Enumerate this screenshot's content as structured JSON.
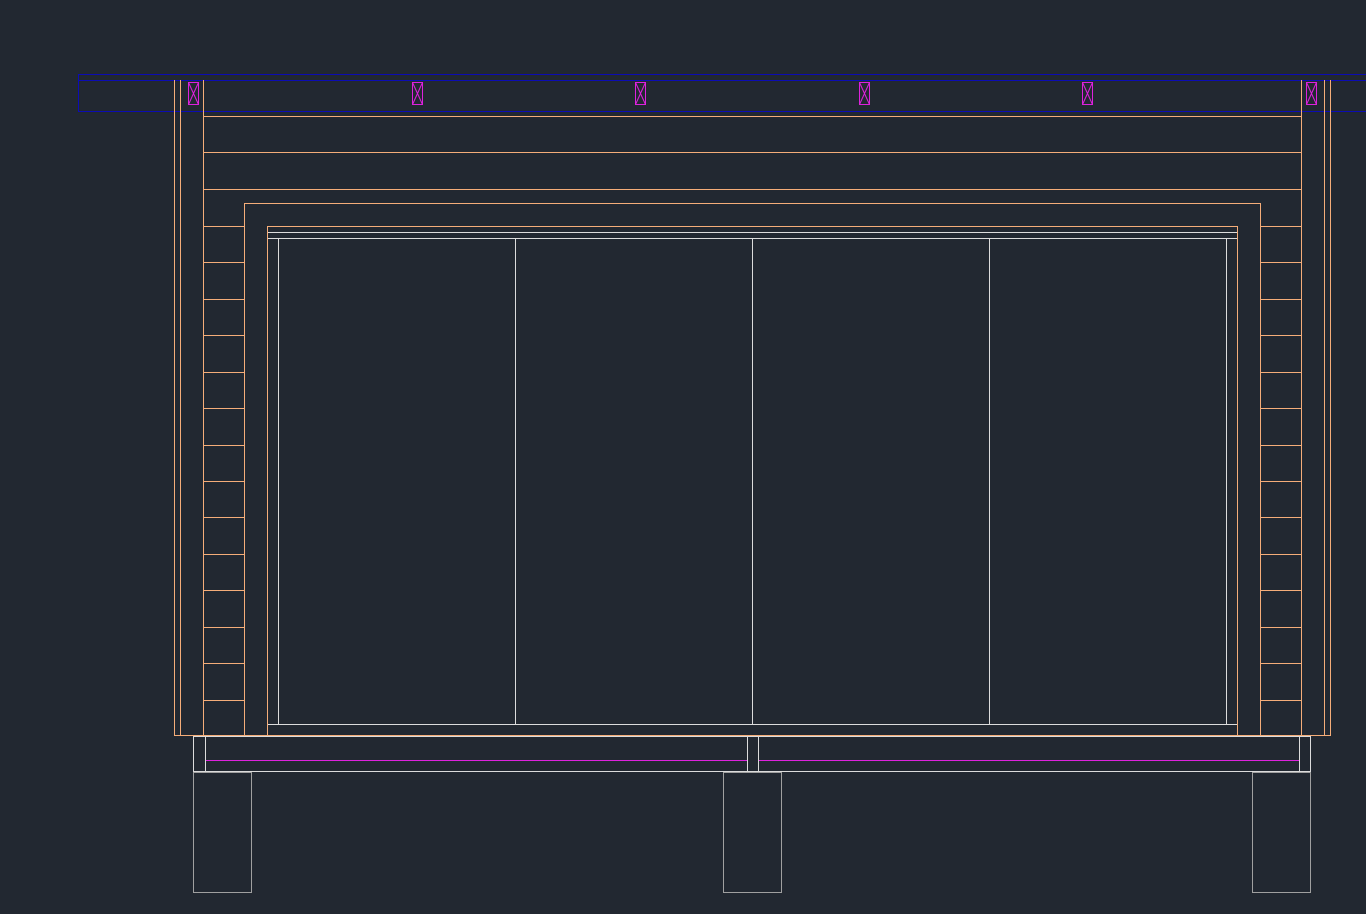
{
  "viewport": {
    "background": "#222831"
  },
  "layers": {
    "structure": "#f5ad79",
    "glazing": "#dcdcdc",
    "footing": "#a0a0a0",
    "beam": "#0c0cb4",
    "joist": "#dd22dd"
  },
  "elevation": {
    "window_panes": 4,
    "side_courses": 14,
    "joists": 6,
    "piers": 3
  }
}
